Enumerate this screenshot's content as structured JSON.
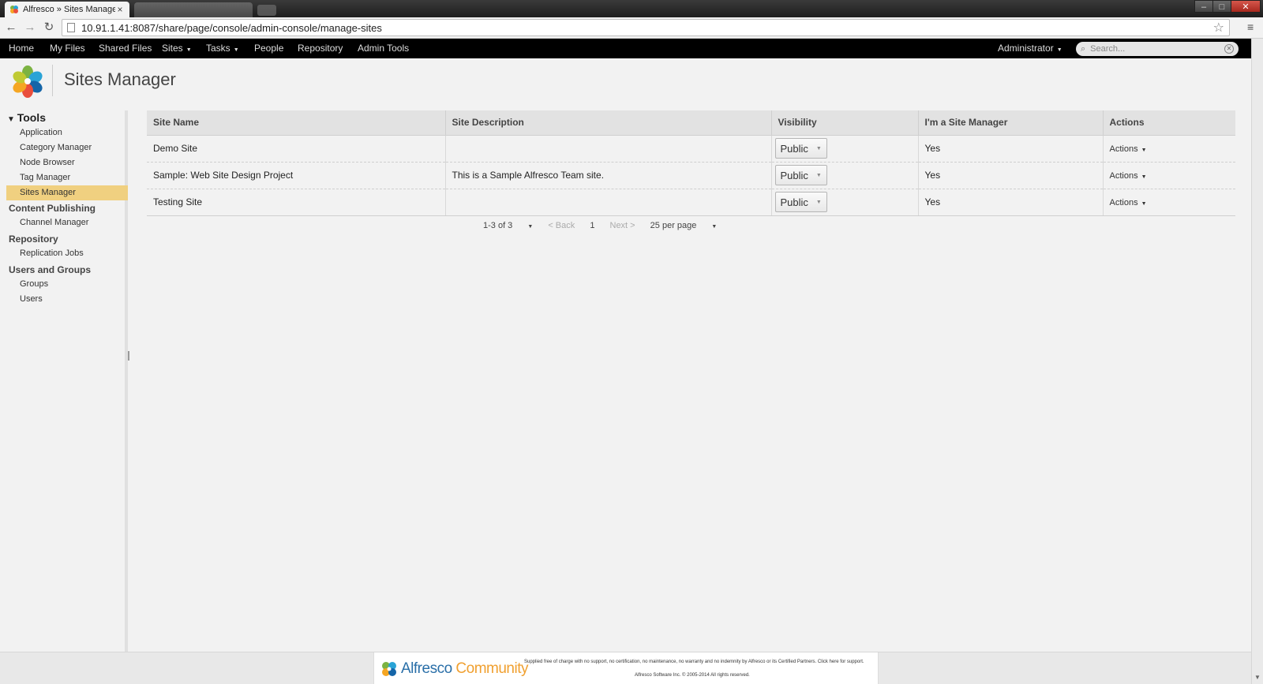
{
  "browser": {
    "tab_title": "Alfresco » Sites Manager",
    "tab_close": "×",
    "url": "10.91.1.41:8087/share/page/console/admin-console/manage-sites",
    "window_controls": {
      "minimize": "–",
      "maximize": "□",
      "close": "✕"
    }
  },
  "appnav": {
    "items": [
      {
        "label": "Home"
      },
      {
        "label": "My Files"
      },
      {
        "label": "Shared Files"
      },
      {
        "label": "Sites",
        "has_menu": true
      },
      {
        "label": "Tasks",
        "has_menu": true
      },
      {
        "label": "People"
      },
      {
        "label": "Repository"
      },
      {
        "label": "Admin Tools"
      }
    ],
    "user_menu": "Administrator",
    "search_placeholder": "Search..."
  },
  "header": {
    "page_title": "Sites Manager"
  },
  "sidebar": {
    "tools_title": "Tools",
    "tools_items": [
      "Application",
      "Category Manager",
      "Node Browser",
      "Tag Manager",
      "Sites Manager"
    ],
    "active_item": "Sites Manager",
    "sections": [
      {
        "title": "Content Publishing",
        "items": [
          "Channel Manager"
        ]
      },
      {
        "title": "Repository",
        "items": [
          "Replication Jobs"
        ]
      },
      {
        "title": "Users and Groups",
        "items": [
          "Groups",
          "Users"
        ]
      }
    ]
  },
  "sites_table": {
    "columns": [
      "Site Name",
      "Site Description",
      "Visibility",
      "I'm a Site Manager",
      "Actions"
    ],
    "rows": [
      {
        "name": "Demo Site",
        "description": "",
        "visibility": "Public",
        "manager": "Yes",
        "actions": "Actions"
      },
      {
        "name": "Sample: Web Site Design Project",
        "description": "This is a Sample Alfresco Team site.",
        "visibility": "Public",
        "manager": "Yes",
        "actions": "Actions"
      },
      {
        "name": "Testing Site",
        "description": "",
        "visibility": "Public",
        "manager": "Yes",
        "actions": "Actions"
      }
    ]
  },
  "paginator": {
    "range": "1-3 of 3",
    "back": "< Back",
    "page": "1",
    "next": "Next >",
    "per_page": "25 per page"
  },
  "footer": {
    "brand": "Alfresco",
    "edition": "Community",
    "notice": "Supplied free of charge with no support, no certification, no maintenance, no warranty and no indemnity by Alfresco or its Certified Partners. Click here for support.",
    "copyright": "Alfresco Software Inc. © 2005-2014 All rights reserved."
  },
  "colors": {
    "nav_bg": "#000000",
    "active_sidebar": "#f0d080",
    "brand_blue": "#2a6fa8",
    "brand_orange": "#f0a030"
  }
}
